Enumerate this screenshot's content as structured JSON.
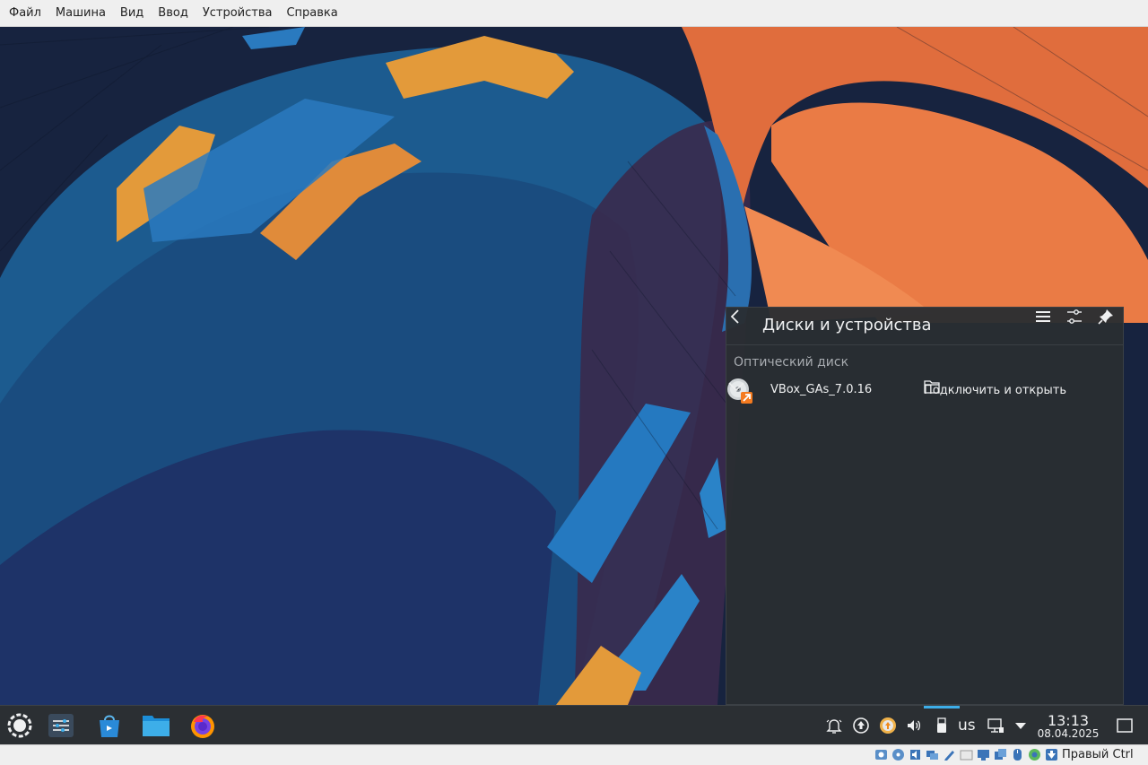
{
  "vbox": {
    "menu": [
      "Файл",
      "Машина",
      "Вид",
      "Ввод",
      "Устройства",
      "Справка"
    ],
    "host_key_label": "Правый Ctrl",
    "status_icons": [
      "hard-disk-icon",
      "optical-disk-icon",
      "audio-icon",
      "network-icon",
      "usb-icon",
      "shared-folders-icon",
      "display-icon",
      "video-capture-icon",
      "mouse-integration-icon",
      "cpu-icon",
      "guest-additions-icon",
      "arrow-down-icon"
    ]
  },
  "popup": {
    "title": "Диски и устройства",
    "section_label": "Оптический диск",
    "device": {
      "name": "VBox_GAs_7.0.16",
      "action_label": "Подключить и открыть"
    }
  },
  "panel": {
    "keyboard_layout": "us",
    "clock_time": "13:13",
    "clock_date": "08.04.2025"
  },
  "colors": {
    "accent": "#3daee9",
    "panel_bg": "#2b2f33",
    "popup_bg": "#2a2e32",
    "menubar_bg": "#efefef"
  }
}
